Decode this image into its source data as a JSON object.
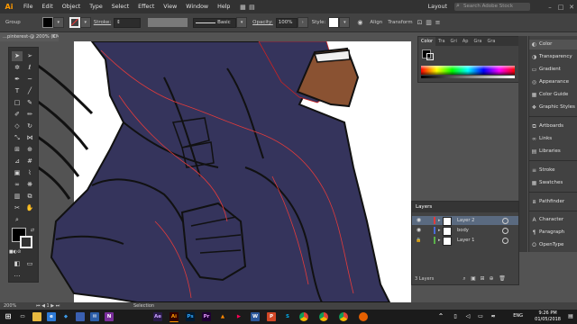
{
  "app": {
    "logo": "Ai"
  },
  "menu": [
    "File",
    "Edit",
    "Object",
    "Type",
    "Select",
    "Effect",
    "View",
    "Window",
    "Help"
  ],
  "menubar_right": {
    "workspace": "Layout",
    "search_placeholder": "Search Adobe Stock"
  },
  "control_bar": {
    "selection_label": "Group",
    "stroke_label": "Stroke:",
    "brush_label": "Basic",
    "opacity_label": "Opacity:",
    "opacity_value": "100%",
    "style_label": "Style:",
    "align_label": "Align",
    "transform_label": "Transform"
  },
  "document": {
    "tab_title": "...pinterest-@ 200% (CMYK/GPU Preview)"
  },
  "color_panel": {
    "tabs": [
      "Color",
      "Tra",
      "Gri",
      "Ap",
      "Gra",
      "Gra"
    ],
    "colors": {
      "fill": "#000000",
      "artwork_fill": "#35345c",
      "skin": "#8a5232"
    }
  },
  "right_dock": {
    "items": [
      "Color",
      "Transparency",
      "Gradient",
      "Appearance",
      "Color Guide",
      "Graphic Styles",
      "Artboards",
      "Links",
      "Libraries",
      "Stroke",
      "Swatches",
      "Pathfinder",
      "Character",
      "Paragraph",
      "OpenType"
    ]
  },
  "layers_panel": {
    "title": "Layers",
    "layers": [
      {
        "name": "Layer 2",
        "color": "#e33b3b",
        "selected": true
      },
      {
        "name": "body",
        "color": "#4a6bd8",
        "selected": false
      },
      {
        "name": "Layer 1",
        "color": "#5ab24a",
        "selected": false
      }
    ],
    "count_label": "3 Layers"
  },
  "status_bar": {
    "zoom": "200%",
    "page": "1",
    "tool": "Selection"
  },
  "taskbar": {
    "language": "ENG",
    "time": "9:26 PM",
    "date": "01/05/2018",
    "app_badges": [
      "Ae",
      "Ai",
      "Ps",
      "Pr"
    ]
  }
}
